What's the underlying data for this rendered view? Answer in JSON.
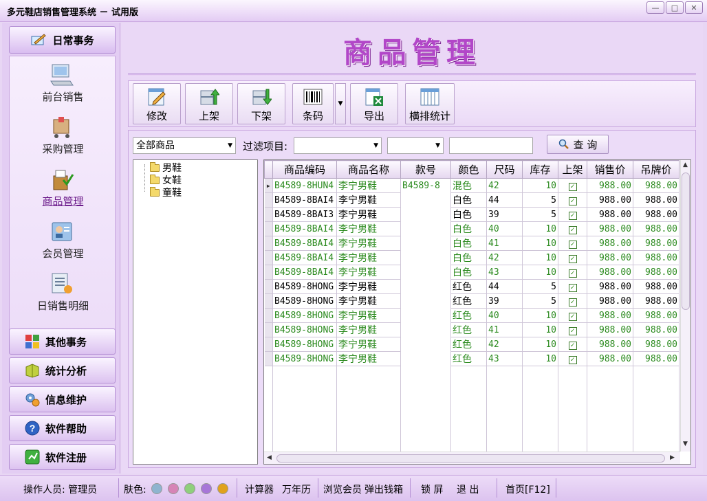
{
  "window": {
    "title": "多元鞋店销售管理系统 － 试用版",
    "minimize": "—",
    "restore": "□",
    "close": "✕"
  },
  "sidebar": {
    "header": "日常事务",
    "items": [
      {
        "label": "前台销售",
        "icon": "computer-icon"
      },
      {
        "label": "采购管理",
        "icon": "cart-icon"
      },
      {
        "label": "商品管理",
        "icon": "goods-icon",
        "active": true
      },
      {
        "label": "会员管理",
        "icon": "member-card-icon"
      },
      {
        "label": "日销售明细",
        "icon": "sales-detail-icon"
      }
    ],
    "categories": [
      {
        "label": "其他事务",
        "icon": "tiles-icon"
      },
      {
        "label": "统计分析",
        "icon": "stats-icon"
      },
      {
        "label": "信息维护",
        "icon": "gears-icon"
      },
      {
        "label": "软件帮助",
        "icon": "help-icon"
      },
      {
        "label": "软件注册",
        "icon": "register-icon"
      }
    ]
  },
  "banner": {
    "title": "商品管理"
  },
  "toolbar": {
    "edit": "修改",
    "shelf_on": "上架",
    "shelf_off": "下架",
    "barcode": "条码",
    "export": "导出",
    "cross_stats": "横排统计"
  },
  "filter": {
    "category_select": "全部商品",
    "filter_label": "过滤项目:",
    "filter_field": "",
    "filter_op": "",
    "filter_value": "",
    "query": "查 询"
  },
  "tree": {
    "nodes": [
      "男鞋",
      "女鞋",
      "童鞋"
    ]
  },
  "table": {
    "headers": [
      "商品编码",
      "商品名称",
      "款号",
      "颜色",
      "尺码",
      "库存",
      "上架",
      "销售价",
      "吊牌价"
    ],
    "rows": [
      {
        "code": "B4589-8HUN4",
        "name": "李宁男鞋",
        "style": "B4589-8",
        "color": "混色",
        "size": "42",
        "stock": "10",
        "on_shelf": true,
        "price": "988.00",
        "tag_price": "988.00",
        "green": true,
        "current": true
      },
      {
        "code": "B4589-8BAI4",
        "name": "李宁男鞋",
        "style": "",
        "color": "白色",
        "size": "44",
        "stock": "5",
        "on_shelf": true,
        "price": "988.00",
        "tag_price": "988.00",
        "green": false
      },
      {
        "code": "B4589-8BAI3",
        "name": "李宁男鞋",
        "style": "",
        "color": "白色",
        "size": "39",
        "stock": "5",
        "on_shelf": true,
        "price": "988.00",
        "tag_price": "988.00",
        "green": false
      },
      {
        "code": "B4589-8BAI4",
        "name": "李宁男鞋",
        "style": "",
        "color": "白色",
        "size": "40",
        "stock": "10",
        "on_shelf": true,
        "price": "988.00",
        "tag_price": "988.00",
        "green": true
      },
      {
        "code": "B4589-8BAI4",
        "name": "李宁男鞋",
        "style": "",
        "color": "白色",
        "size": "41",
        "stock": "10",
        "on_shelf": true,
        "price": "988.00",
        "tag_price": "988.00",
        "green": true
      },
      {
        "code": "B4589-8BAI4",
        "name": "李宁男鞋",
        "style": "",
        "color": "白色",
        "size": "42",
        "stock": "10",
        "on_shelf": true,
        "price": "988.00",
        "tag_price": "988.00",
        "green": true
      },
      {
        "code": "B4589-8BAI4",
        "name": "李宁男鞋",
        "style": "",
        "color": "白色",
        "size": "43",
        "stock": "10",
        "on_shelf": true,
        "price": "988.00",
        "tag_price": "988.00",
        "green": true
      },
      {
        "code": "B4589-8HONG",
        "name": "李宁男鞋",
        "style": "",
        "color": "红色",
        "size": "44",
        "stock": "5",
        "on_shelf": true,
        "price": "988.00",
        "tag_price": "988.00",
        "green": false
      },
      {
        "code": "B4589-8HONG",
        "name": "李宁男鞋",
        "style": "",
        "color": "红色",
        "size": "39",
        "stock": "5",
        "on_shelf": true,
        "price": "988.00",
        "tag_price": "988.00",
        "green": false
      },
      {
        "code": "B4589-8HONG",
        "name": "李宁男鞋",
        "style": "",
        "color": "红色",
        "size": "40",
        "stock": "10",
        "on_shelf": true,
        "price": "988.00",
        "tag_price": "988.00",
        "green": true
      },
      {
        "code": "B4589-8HONG",
        "name": "李宁男鞋",
        "style": "",
        "color": "红色",
        "size": "41",
        "stock": "10",
        "on_shelf": true,
        "price": "988.00",
        "tag_price": "988.00",
        "green": true
      },
      {
        "code": "B4589-8HONG",
        "name": "李宁男鞋",
        "style": "",
        "color": "红色",
        "size": "42",
        "stock": "10",
        "on_shelf": true,
        "price": "988.00",
        "tag_price": "988.00",
        "green": true
      },
      {
        "code": "B4589-8HONG",
        "name": "李宁男鞋",
        "style": "",
        "color": "红色",
        "size": "43",
        "stock": "10",
        "on_shelf": true,
        "price": "988.00",
        "tag_price": "988.00",
        "green": true
      }
    ]
  },
  "statusbar": {
    "operator": "操作人员: 管理员",
    "skin_label": "肤色:",
    "skins": [
      "#8fb4cf",
      "#d684b6",
      "#8fcf7c",
      "#a776d8",
      "#e0a21c"
    ],
    "calculator": "计算器",
    "calendar": "万年历",
    "browse_members": "浏览会员",
    "cash_drawer": "弹出钱箱",
    "lock": "锁 屏",
    "exit": "退 出",
    "home": "首页[F12]"
  },
  "colors": {
    "accent": "#b247c8",
    "green_row": "#2b8a1e",
    "sidebar_bg": "#e3cdf3"
  }
}
